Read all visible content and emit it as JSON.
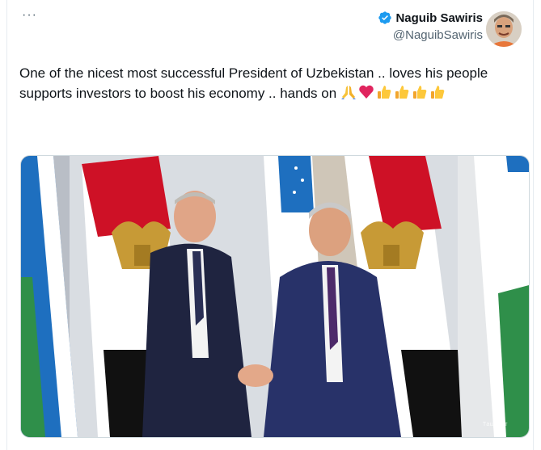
{
  "menu": {
    "more_label": "···"
  },
  "author": {
    "display_name": "Naguib Sawiris",
    "handle": "@NaguibSawiris",
    "verified": true,
    "verified_color": "#1d9bf0"
  },
  "tweet": {
    "text": "One of the nicest most successful President of Uzbekistan .. loves his people supports investors to boost his economy .. hands on",
    "emojis": [
      "folded-hands",
      "red-heart",
      "thumbs-up",
      "thumbs-up",
      "thumbs-up",
      "thumbs-up"
    ]
  },
  "media": {
    "alt": "Photo of two men shaking hands in front of Egyptian and Uzbek flags",
    "watermark": "Ташкент"
  }
}
